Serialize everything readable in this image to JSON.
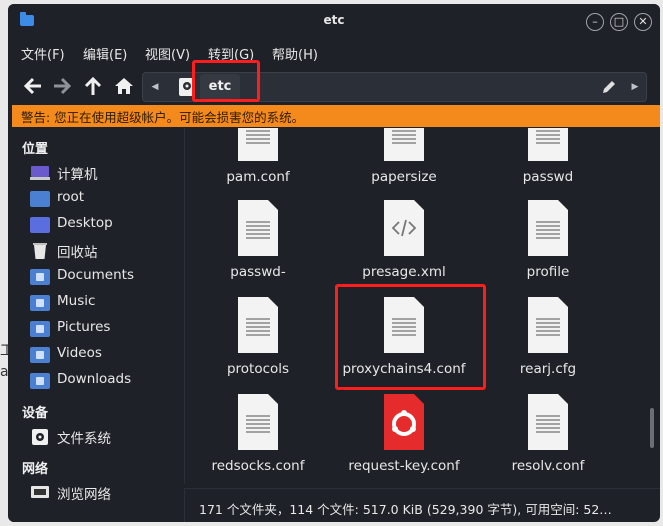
{
  "window": {
    "title": "etc"
  },
  "menu": [
    "文件(F)",
    "编辑(E)",
    "视图(V)",
    "转到(G)",
    "帮助(H)"
  ],
  "path": {
    "segment": "etc"
  },
  "warning": "警告: 您正在使用超级帐户。可能会损害您的系统。",
  "sidebar": {
    "places_header": "位置",
    "places": [
      {
        "label": "计算机",
        "icon": "computer-icon"
      },
      {
        "label": "root",
        "icon": "home-folder-icon"
      },
      {
        "label": "Desktop",
        "icon": "desktop-folder-icon"
      },
      {
        "label": "回收站",
        "icon": "trash-icon"
      },
      {
        "label": "Documents",
        "icon": "documents-folder-icon"
      },
      {
        "label": "Music",
        "icon": "music-folder-icon"
      },
      {
        "label": "Pictures",
        "icon": "pictures-folder-icon"
      },
      {
        "label": "Videos",
        "icon": "videos-folder-icon"
      },
      {
        "label": "Downloads",
        "icon": "downloads-folder-icon"
      }
    ],
    "devices_header": "设备",
    "devices": [
      {
        "label": "文件系统",
        "icon": "filesystem-icon"
      }
    ],
    "network_header": "网络",
    "network": [
      {
        "label": "浏览网络",
        "icon": "network-icon"
      }
    ]
  },
  "files": [
    {
      "name": "pam.conf",
      "icon": "text-file-icon"
    },
    {
      "name": "papersize",
      "icon": "text-file-icon"
    },
    {
      "name": "passwd",
      "icon": "text-file-icon"
    },
    {
      "name": "passwd-",
      "icon": "text-file-icon"
    },
    {
      "name": "presage.xml",
      "icon": "xml-file-icon"
    },
    {
      "name": "profile",
      "icon": "text-file-icon"
    },
    {
      "name": "protocols",
      "icon": "text-file-icon"
    },
    {
      "name": "proxychains4.conf",
      "icon": "text-file-icon"
    },
    {
      "name": "rearj.cfg",
      "icon": "text-file-icon"
    },
    {
      "name": "redsocks.conf",
      "icon": "text-file-icon"
    },
    {
      "name": "request-key.conf",
      "icon": "red-app-file-icon"
    },
    {
      "name": "resolv.conf",
      "icon": "text-file-icon"
    }
  ],
  "status": "171 个文件夹，114 个文件: 517.0 KiB (529,390 字节), 可用空间: 52…",
  "colors": {
    "accent": "#3d8be8",
    "warning_bg": "#f58a1c",
    "highlight": "#ff1e1e",
    "window_bg": "#1e2128"
  }
}
